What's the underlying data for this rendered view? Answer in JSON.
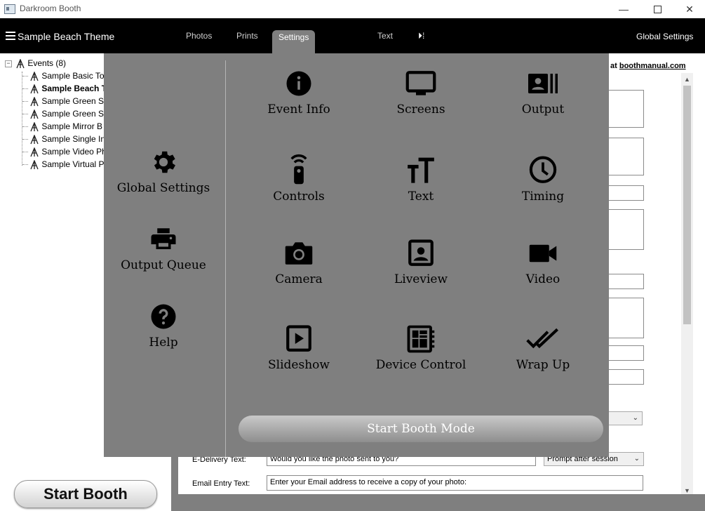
{
  "window": {
    "title": "Darkroom Booth",
    "min_glyph": "—",
    "close_glyph": "✕"
  },
  "topnav": {
    "theme_title": "Sample Beach Theme",
    "tabs": [
      "Photos",
      "Prints",
      "Settings",
      "Text"
    ],
    "arrow_glyph": "⏵⁞",
    "active_tab": "Settings",
    "global_settings": "Global Settings"
  },
  "tree": {
    "expander": "−",
    "root": "Events (8)",
    "items": [
      "Sample Basic To",
      "Sample Beach T",
      "Sample Green Sc",
      "Sample Green Sc",
      "Sample Mirror B",
      "Sample Single In",
      "Sample Video Ph",
      "Sample Virtual P"
    ],
    "selected": "Sample Beach T"
  },
  "start_booth": "Start Booth",
  "form": {
    "link_prefix": "at ",
    "link_text": "boothmanual.com",
    "edelivery_label": "E-Delivery Text:",
    "edelivery_value": "Would you like the photo sent to you?",
    "edelivery_option": "Prompt after session",
    "email_label": "Email Entry Text:",
    "email_value": "Enter your Email address to receive a copy of your photo:",
    "chevron": "⌄",
    "scroll_up": "▲",
    "scroll_down": "▼"
  },
  "menu": {
    "left": [
      {
        "label": "Global Settings",
        "icon": "gear-icon"
      },
      {
        "label": "Output Queue",
        "icon": "printer-icon"
      },
      {
        "label": "Help",
        "icon": "help-icon"
      }
    ],
    "grid": [
      {
        "label": "Event Info",
        "icon": "info-icon"
      },
      {
        "label": "Screens",
        "icon": "monitor-icon"
      },
      {
        "label": "Output",
        "icon": "output-icon"
      },
      {
        "label": "Controls",
        "icon": "remote-icon"
      },
      {
        "label": "Text",
        "icon": "text-size-icon"
      },
      {
        "label": "Timing",
        "icon": "clock-icon"
      },
      {
        "label": "Camera",
        "icon": "camera-icon"
      },
      {
        "label": "Liveview",
        "icon": "portrait-icon"
      },
      {
        "label": "Video",
        "icon": "video-icon"
      },
      {
        "label": "Slideshow",
        "icon": "slideshow-icon"
      },
      {
        "label": "Device Control",
        "icon": "device-control-icon"
      },
      {
        "label": "Wrap Up",
        "icon": "double-check-icon"
      }
    ],
    "start_mode": "Start Booth Mode"
  },
  "colors": {
    "overlay": "#7f7f7f",
    "nav": "#000000",
    "active_tab": "#7f7f7f"
  }
}
